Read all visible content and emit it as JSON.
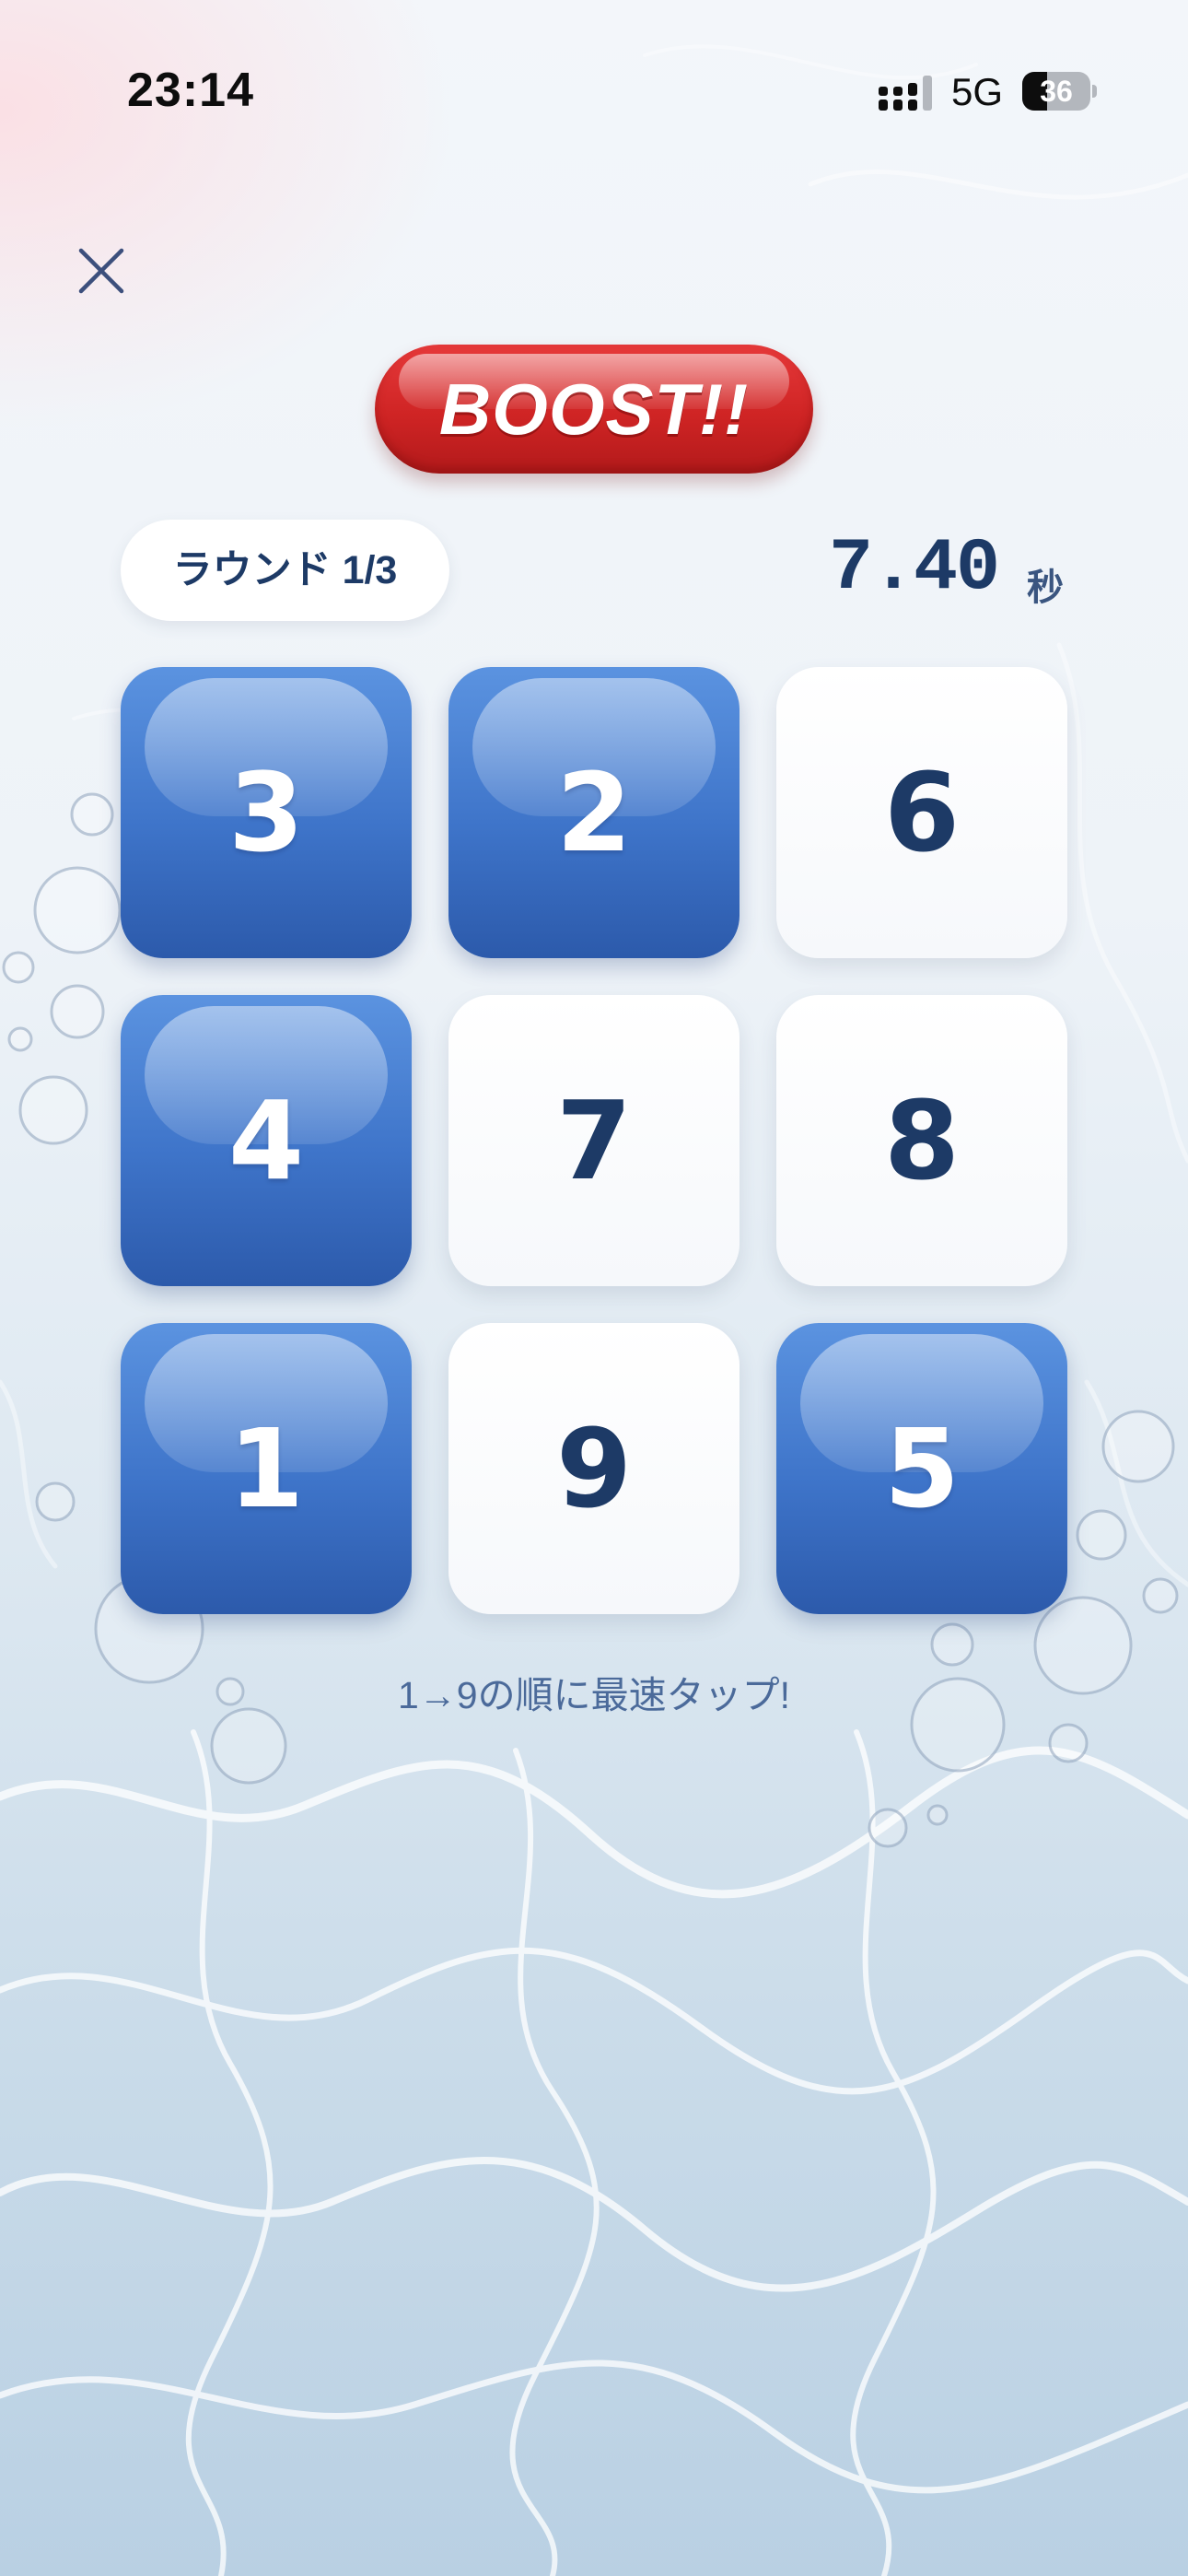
{
  "status_bar": {
    "time": "23:14",
    "network": "5G",
    "battery_percent": "36",
    "battery_level": 0.36
  },
  "header": {
    "close_icon": "close-icon",
    "logo_text": "BOOST!!"
  },
  "game": {
    "round_label": "ラウンド 1/3",
    "timer_value": "7.40",
    "timer_unit": "秒",
    "tiles": [
      {
        "number": "3",
        "state": "tapped"
      },
      {
        "number": "2",
        "state": "tapped"
      },
      {
        "number": "6",
        "state": "untapped"
      },
      {
        "number": "4",
        "state": "tapped"
      },
      {
        "number": "7",
        "state": "untapped"
      },
      {
        "number": "8",
        "state": "untapped"
      },
      {
        "number": "1",
        "state": "tapped"
      },
      {
        "number": "9",
        "state": "untapped"
      },
      {
        "number": "5",
        "state": "tapped"
      }
    ],
    "instruction": "1→9の順に最速タップ!"
  },
  "colors": {
    "tile_tapped": "#3e74c9",
    "tile_untapped": "#ffffff",
    "text_primary": "#1d3a66",
    "boost_red": "#cf2424"
  }
}
